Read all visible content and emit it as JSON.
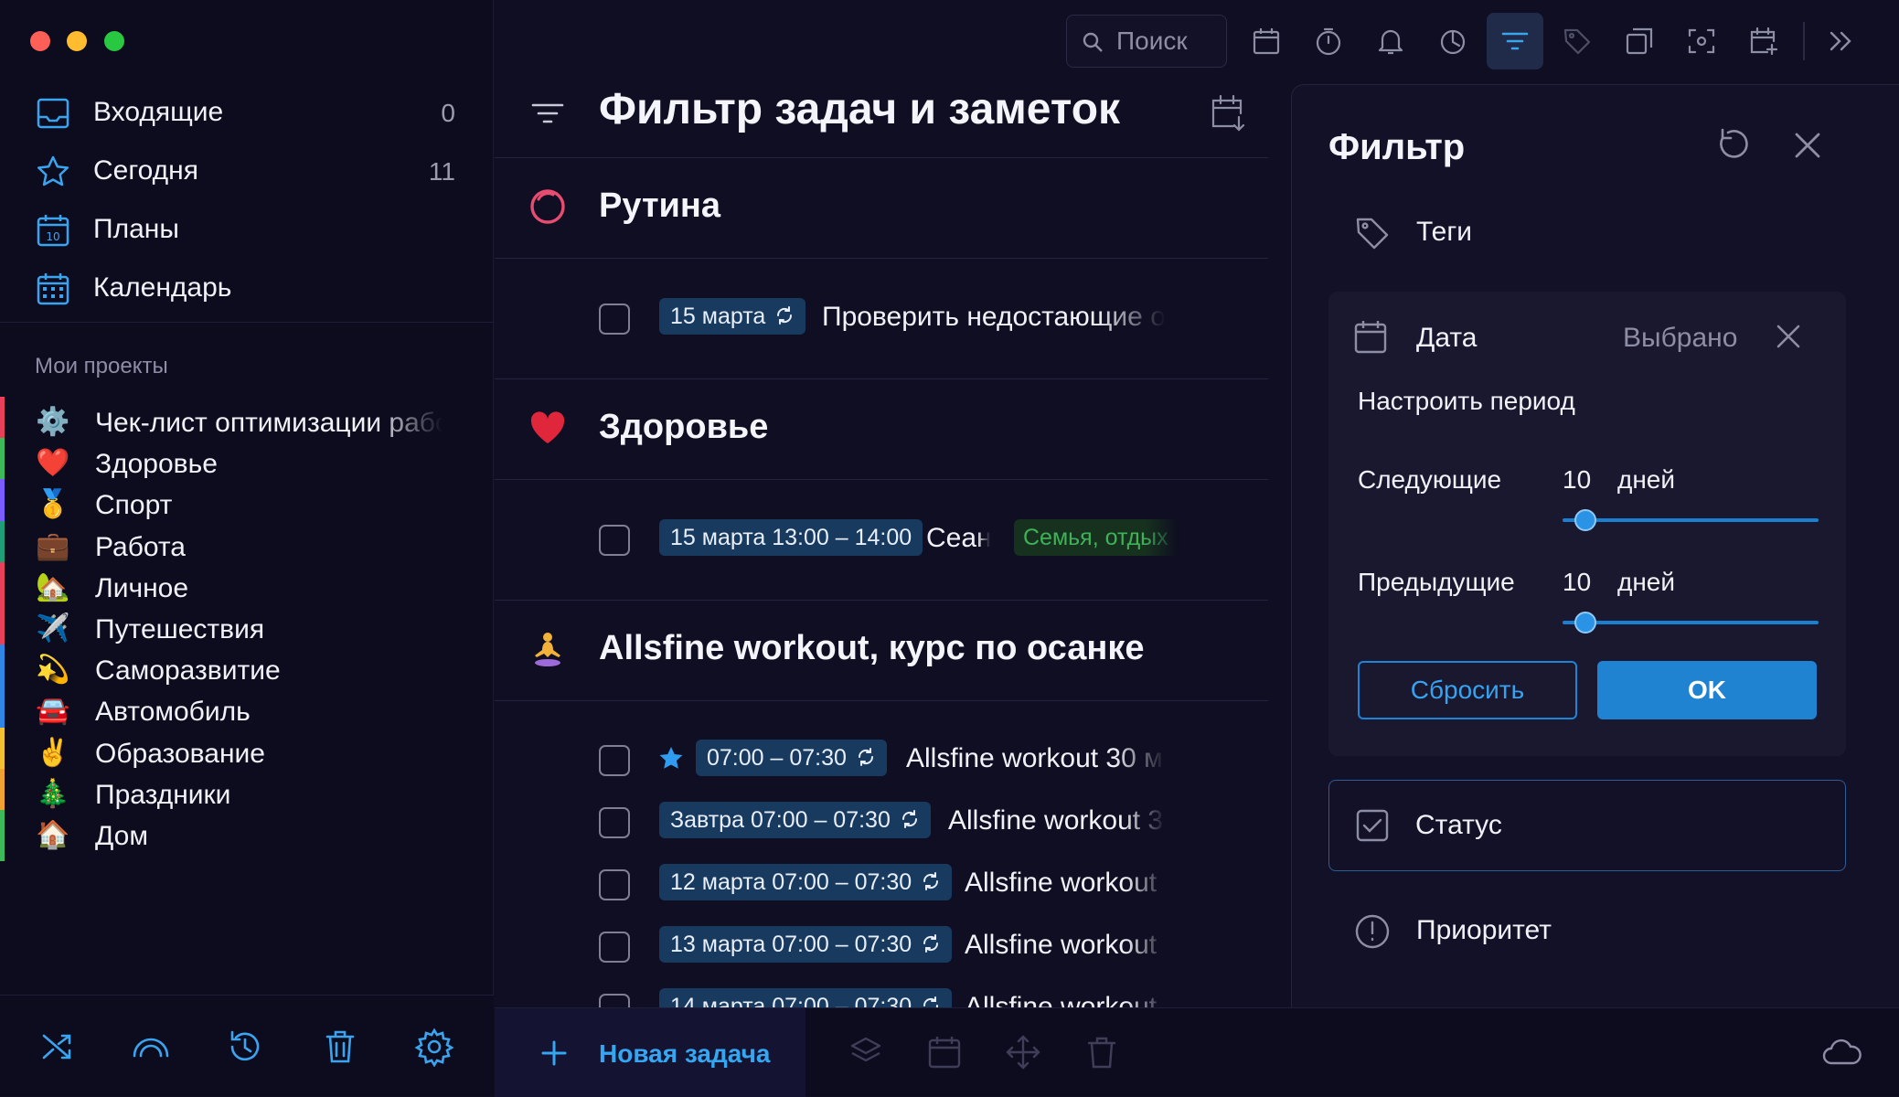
{
  "window": {
    "controls": [
      "close",
      "minimize",
      "zoom"
    ],
    "colors": {
      "close": "#fe5f57",
      "minimize": "#febc2e",
      "zoom": "#28c840"
    }
  },
  "sidebar": {
    "nav": [
      {
        "label": "Входящие",
        "count": "0",
        "icon": "inbox-icon"
      },
      {
        "label": "Сегодня",
        "count": "11",
        "icon": "star-icon"
      },
      {
        "label": "Планы",
        "count": "",
        "icon": "calendar-10-icon"
      },
      {
        "label": "Календарь",
        "count": "",
        "icon": "calendar-grid-icon"
      }
    ],
    "section_title": "Мои проекты",
    "projects": [
      {
        "label": "Чек-лист оптимизации работы",
        "emoji": "⚙️",
        "color": "#e8405a"
      },
      {
        "label": "Здоровье",
        "emoji": "❤️",
        "color": "#3cba5a"
      },
      {
        "label": "Спорт",
        "emoji": "🥇",
        "color": "#7b5cff"
      },
      {
        "label": "Работа",
        "emoji": "💼",
        "color": "#1f9c78"
      },
      {
        "label": "Личное",
        "emoji": "🏡",
        "color": "#e8405a"
      },
      {
        "label": "Путешествия",
        "emoji": "✈️",
        "color": "#e8405a"
      },
      {
        "label": "Саморазвитие",
        "emoji": "💫",
        "color": "#2f86e6"
      },
      {
        "label": "Автомобиль",
        "emoji": "🚘",
        "color": "#2f86e6"
      },
      {
        "label": "Образование",
        "emoji": "✌️",
        "color": "#f2c230"
      },
      {
        "label": "Праздники",
        "emoji": "🎄",
        "color": "#f2a230"
      },
      {
        "label": "Дом",
        "emoji": "🏠",
        "color": "#3cba5a"
      }
    ],
    "bottom_icons": [
      "shuffle-icon",
      "rainbow-icon",
      "history-icon",
      "trash-icon",
      "settings-icon"
    ]
  },
  "toolbar": {
    "search_placeholder": "Поиск",
    "icons": [
      "calendar-icon",
      "timer-icon",
      "bell-icon",
      "pomodoro-icon",
      "filter-icon",
      "tag-icon",
      "export-icon",
      "focus-icon",
      "add-calendar-icon",
      "more-icon"
    ],
    "active": "filter-icon"
  },
  "main": {
    "title": "Фильтр задач и заметок",
    "groups": [
      {
        "title": "Рутина",
        "icon": "routine-circle-icon",
        "tasks": [
          {
            "chip": "15 марта",
            "repeat": true,
            "title": "Проверить недостающие о"
          }
        ]
      },
      {
        "title": "Здоровье",
        "icon": "heart-icon",
        "tasks": [
          {
            "chip": "15 марта 13:00 – 14:00",
            "repeat": false,
            "title": "Сеан",
            "tag": "Семья, отдых"
          }
        ]
      },
      {
        "title": "Allsfine workout, курс по осанке",
        "icon": "yoga-icon",
        "tasks": [
          {
            "chip": "07:00 – 07:30",
            "repeat": true,
            "starred": true,
            "title": "Allsfine workout 30 м"
          },
          {
            "chip": "Завтра 07:00 – 07:30",
            "repeat": true,
            "title": "Allsfine workout 3"
          },
          {
            "chip": "12 марта 07:00 – 07:30",
            "repeat": true,
            "title": "Allsfine workout"
          },
          {
            "chip": "13 марта 07:00 – 07:30",
            "repeat": true,
            "title": "Allsfine workout"
          },
          {
            "chip": "14 марта 07:00 – 07:30",
            "repeat": true,
            "title": "Allsfine workout"
          }
        ]
      }
    ],
    "new_task": "Новая задача",
    "bottom_icons": [
      "layers-icon",
      "calendar-icon",
      "move-icon",
      "trash-icon",
      "cloud-icon"
    ]
  },
  "filter": {
    "title": "Фильтр",
    "tags_label": "Теги",
    "date": {
      "label": "Дата",
      "state": "Выбрано",
      "period_title": "Настроить период",
      "next": {
        "label": "Следующие",
        "value": "10",
        "unit": "дней",
        "level": 0.05
      },
      "prev": {
        "label": "Предыдущие",
        "value": "10",
        "unit": "дней",
        "level": 0.05
      },
      "reset": "Сбросить",
      "ok": "OK"
    },
    "status_label": "Статус",
    "priority_label": "Приоритет"
  },
  "colors": {
    "accent": "#1f83d2",
    "chip_bg": "#173a5e",
    "tag_green": "#3fb158",
    "background": "#0f0e22"
  }
}
